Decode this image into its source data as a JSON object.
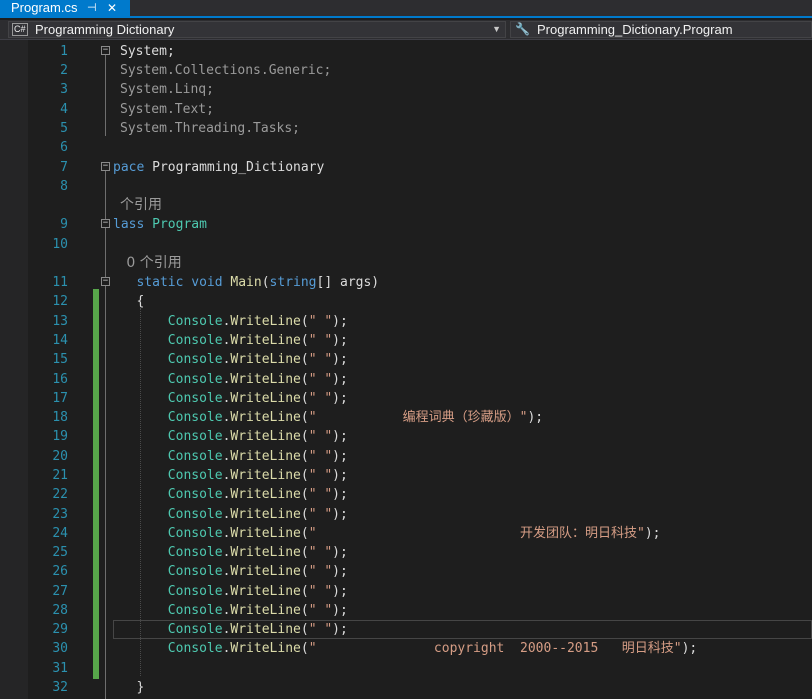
{
  "tab": {
    "title": "Program.cs",
    "pin_icon": "pin-icon",
    "close_icon": "close-icon"
  },
  "navbar": {
    "project": "Programming Dictionary",
    "project_icon": "csharp-icon",
    "member": "Programming_Dictionary.Program",
    "member_icon": "wrench-icon"
  },
  "colors": {
    "accent": "#007acc",
    "line_number": "#2b91af",
    "keyword": "#569cd6",
    "type": "#4ec9b0",
    "method": "#dcdcaa",
    "string": "#d69d85",
    "changed": "#57a64a",
    "background": "#1e1e1e"
  },
  "editor": {
    "current_line": "29",
    "lines": [
      {
        "n": "1",
        "tokens": [
          {
            "t": "System",
            "c": "plain"
          },
          {
            "t": ";",
            "c": "plain"
          }
        ]
      },
      {
        "n": "2",
        "tokens": [
          {
            "t": "System.Collections.Generic;",
            "c": "gray"
          }
        ]
      },
      {
        "n": "3",
        "tokens": [
          {
            "t": "System.Linq;",
            "c": "gray"
          }
        ]
      },
      {
        "n": "4",
        "tokens": [
          {
            "t": "System.Text;",
            "c": "gray"
          }
        ]
      },
      {
        "n": "5",
        "tokens": [
          {
            "t": "System.Threading.Tasks;",
            "c": "gray"
          }
        ]
      },
      {
        "n": "6",
        "tokens": []
      },
      {
        "n": "7",
        "tokens": [
          {
            "t": "pace",
            "c": "kw"
          },
          {
            "t": " Programming_Dictionary",
            "c": "plain"
          }
        ]
      },
      {
        "n": "8",
        "tokens": []
      },
      {
        "n": "",
        "tokens": [
          {
            "t": "个引用",
            "c": "ref"
          }
        ]
      },
      {
        "n": "9",
        "tokens": [
          {
            "t": "lass",
            "c": "kw"
          },
          {
            "t": " Program",
            "c": "type"
          }
        ]
      },
      {
        "n": "10",
        "tokens": []
      },
      {
        "n": "",
        "tokens": [
          {
            "t": "   0 个引用",
            "c": "ref"
          }
        ]
      },
      {
        "n": "11",
        "tokens": [
          {
            "t": "   static void ",
            "c": "kw"
          },
          {
            "t": "Main",
            "c": "method"
          },
          {
            "t": "(",
            "c": "plain"
          },
          {
            "t": "string",
            "c": "kw"
          },
          {
            "t": "[] args)",
            "c": "plain"
          }
        ]
      },
      {
        "n": "12",
        "tokens": [
          {
            "t": "   {",
            "c": "plain"
          }
        ]
      },
      {
        "n": "13",
        "tokens": [
          {
            "t": "       Console",
            "c": "type"
          },
          {
            "t": ".",
            "c": "plain"
          },
          {
            "t": "WriteLine",
            "c": "method"
          },
          {
            "t": "(",
            "c": "plain"
          },
          {
            "t": "\" \"",
            "c": "str"
          },
          {
            "t": ");",
            "c": "plain"
          }
        ]
      },
      {
        "n": "14",
        "tokens": [
          {
            "t": "       Console",
            "c": "type"
          },
          {
            "t": ".",
            "c": "plain"
          },
          {
            "t": "WriteLine",
            "c": "method"
          },
          {
            "t": "(",
            "c": "plain"
          },
          {
            "t": "\" \"",
            "c": "str"
          },
          {
            "t": ");",
            "c": "plain"
          }
        ]
      },
      {
        "n": "15",
        "tokens": [
          {
            "t": "       Console",
            "c": "type"
          },
          {
            "t": ".",
            "c": "plain"
          },
          {
            "t": "WriteLine",
            "c": "method"
          },
          {
            "t": "(",
            "c": "plain"
          },
          {
            "t": "\" \"",
            "c": "str"
          },
          {
            "t": ");",
            "c": "plain"
          }
        ]
      },
      {
        "n": "16",
        "tokens": [
          {
            "t": "       Console",
            "c": "type"
          },
          {
            "t": ".",
            "c": "plain"
          },
          {
            "t": "WriteLine",
            "c": "method"
          },
          {
            "t": "(",
            "c": "plain"
          },
          {
            "t": "\" \"",
            "c": "str"
          },
          {
            "t": ");",
            "c": "plain"
          }
        ]
      },
      {
        "n": "17",
        "tokens": [
          {
            "t": "       Console",
            "c": "type"
          },
          {
            "t": ".",
            "c": "plain"
          },
          {
            "t": "WriteLine",
            "c": "method"
          },
          {
            "t": "(",
            "c": "plain"
          },
          {
            "t": "\" \"",
            "c": "str"
          },
          {
            "t": ");",
            "c": "plain"
          }
        ]
      },
      {
        "n": "18",
        "tokens": [
          {
            "t": "       Console",
            "c": "type"
          },
          {
            "t": ".",
            "c": "plain"
          },
          {
            "t": "WriteLine",
            "c": "method"
          },
          {
            "t": "(",
            "c": "plain"
          },
          {
            "t": "\"           编程词典（珍藏版）\"",
            "c": "str"
          },
          {
            "t": ");",
            "c": "plain"
          }
        ]
      },
      {
        "n": "19",
        "tokens": [
          {
            "t": "       Console",
            "c": "type"
          },
          {
            "t": ".",
            "c": "plain"
          },
          {
            "t": "WriteLine",
            "c": "method"
          },
          {
            "t": "(",
            "c": "plain"
          },
          {
            "t": "\" \"",
            "c": "str"
          },
          {
            "t": ");",
            "c": "plain"
          }
        ]
      },
      {
        "n": "20",
        "tokens": [
          {
            "t": "       Console",
            "c": "type"
          },
          {
            "t": ".",
            "c": "plain"
          },
          {
            "t": "WriteLine",
            "c": "method"
          },
          {
            "t": "(",
            "c": "plain"
          },
          {
            "t": "\" \"",
            "c": "str"
          },
          {
            "t": ");",
            "c": "plain"
          }
        ]
      },
      {
        "n": "21",
        "tokens": [
          {
            "t": "       Console",
            "c": "type"
          },
          {
            "t": ".",
            "c": "plain"
          },
          {
            "t": "WriteLine",
            "c": "method"
          },
          {
            "t": "(",
            "c": "plain"
          },
          {
            "t": "\" \"",
            "c": "str"
          },
          {
            "t": ");",
            "c": "plain"
          }
        ]
      },
      {
        "n": "22",
        "tokens": [
          {
            "t": "       Console",
            "c": "type"
          },
          {
            "t": ".",
            "c": "plain"
          },
          {
            "t": "WriteLine",
            "c": "method"
          },
          {
            "t": "(",
            "c": "plain"
          },
          {
            "t": "\" \"",
            "c": "str"
          },
          {
            "t": ");",
            "c": "plain"
          }
        ]
      },
      {
        "n": "23",
        "tokens": [
          {
            "t": "       Console",
            "c": "type"
          },
          {
            "t": ".",
            "c": "plain"
          },
          {
            "t": "WriteLine",
            "c": "method"
          },
          {
            "t": "(",
            "c": "plain"
          },
          {
            "t": "\" \"",
            "c": "str"
          },
          {
            "t": ");",
            "c": "plain"
          }
        ]
      },
      {
        "n": "24",
        "tokens": [
          {
            "t": "       Console",
            "c": "type"
          },
          {
            "t": ".",
            "c": "plain"
          },
          {
            "t": "WriteLine",
            "c": "method"
          },
          {
            "t": "(",
            "c": "plain"
          },
          {
            "t": "\"                          开发团队：明日科技\"",
            "c": "str"
          },
          {
            "t": ");",
            "c": "plain"
          }
        ]
      },
      {
        "n": "25",
        "tokens": [
          {
            "t": "       Console",
            "c": "type"
          },
          {
            "t": ".",
            "c": "plain"
          },
          {
            "t": "WriteLine",
            "c": "method"
          },
          {
            "t": "(",
            "c": "plain"
          },
          {
            "t": "\" \"",
            "c": "str"
          },
          {
            "t": ");",
            "c": "plain"
          }
        ]
      },
      {
        "n": "26",
        "tokens": [
          {
            "t": "       Console",
            "c": "type"
          },
          {
            "t": ".",
            "c": "plain"
          },
          {
            "t": "WriteLine",
            "c": "method"
          },
          {
            "t": "(",
            "c": "plain"
          },
          {
            "t": "\" \"",
            "c": "str"
          },
          {
            "t": ");",
            "c": "plain"
          }
        ]
      },
      {
        "n": "27",
        "tokens": [
          {
            "t": "       Console",
            "c": "type"
          },
          {
            "t": ".",
            "c": "plain"
          },
          {
            "t": "WriteLine",
            "c": "method"
          },
          {
            "t": "(",
            "c": "plain"
          },
          {
            "t": "\" \"",
            "c": "str"
          },
          {
            "t": ");",
            "c": "plain"
          }
        ]
      },
      {
        "n": "28",
        "tokens": [
          {
            "t": "       Console",
            "c": "type"
          },
          {
            "t": ".",
            "c": "plain"
          },
          {
            "t": "WriteLine",
            "c": "method"
          },
          {
            "t": "(",
            "c": "plain"
          },
          {
            "t": "\" \"",
            "c": "str"
          },
          {
            "t": ");",
            "c": "plain"
          }
        ]
      },
      {
        "n": "29",
        "tokens": [
          {
            "t": "       Console",
            "c": "type"
          },
          {
            "t": ".",
            "c": "plain"
          },
          {
            "t": "WriteLine",
            "c": "method"
          },
          {
            "t": "(",
            "c": "plain"
          },
          {
            "t": "\" \"",
            "c": "str"
          },
          {
            "t": ");",
            "c": "plain"
          }
        ]
      },
      {
        "n": "30",
        "tokens": [
          {
            "t": "       Console",
            "c": "type"
          },
          {
            "t": ".",
            "c": "plain"
          },
          {
            "t": "WriteLine",
            "c": "method"
          },
          {
            "t": "(",
            "c": "plain"
          },
          {
            "t": "\"               copyright  2000--2015   明日科技\"",
            "c": "str"
          },
          {
            "t": ");",
            "c": "plain"
          }
        ]
      },
      {
        "n": "31",
        "tokens": []
      },
      {
        "n": "32",
        "tokens": [
          {
            "t": "   }",
            "c": "plain"
          }
        ]
      }
    ]
  }
}
